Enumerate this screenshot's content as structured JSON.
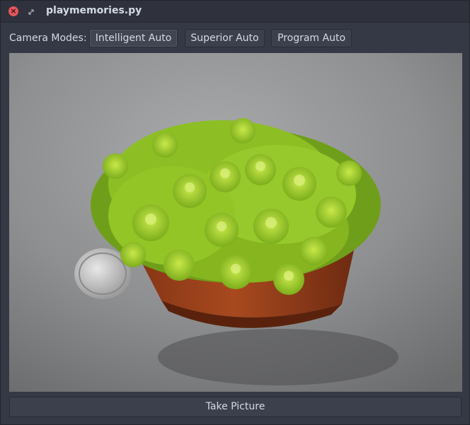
{
  "window": {
    "title": "playmemories.py",
    "close_glyph": "×"
  },
  "toolbar": {
    "modes_label": "Camera Modes:",
    "modes": [
      {
        "label": "Intelligent Auto",
        "active": true
      },
      {
        "label": "Superior Auto",
        "active": false
      },
      {
        "label": "Program Auto",
        "active": false
      }
    ]
  },
  "viewfinder": {
    "subject": "potted succulent with coin"
  },
  "actions": {
    "take_picture_label": "Take Picture"
  },
  "colors": {
    "background": "#353945",
    "close": "#e4575b",
    "text": "#d3dae3"
  }
}
